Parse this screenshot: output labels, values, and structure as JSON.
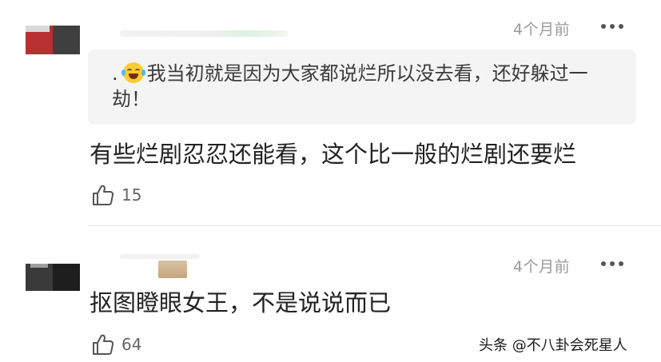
{
  "comments": [
    {
      "time": "4个月前",
      "quote": {
        "prefix": ".",
        "emoji": "laughing-with-tears-emoji",
        "text": "我当初就是因为大家都说烂所以没去看，还好躲过一劫！"
      },
      "text": "有些烂剧忍忍还能看，这个比一般的烂剧还要烂",
      "likes": "15"
    },
    {
      "time": "4个月前",
      "text": "抠图瞪眼女王，不是说说而已",
      "likes": "64"
    }
  ],
  "watermark": "头条 @不八卦会死星人",
  "colors": {
    "quote_bg": "#f4f4f4",
    "meta_text": "#9a9a9a",
    "divider": "#e6e6e6"
  }
}
